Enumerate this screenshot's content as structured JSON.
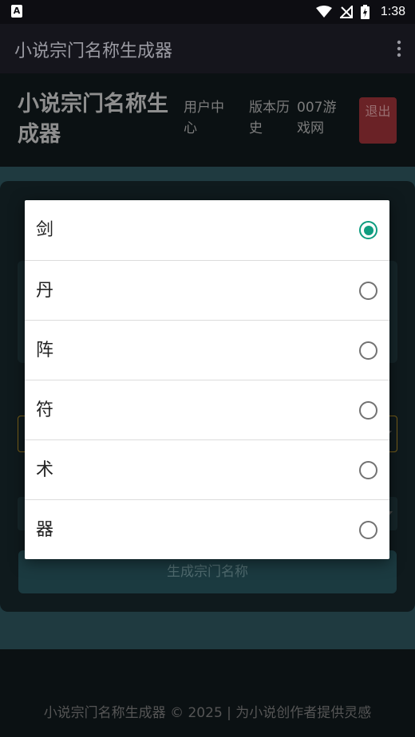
{
  "status_bar": {
    "time": "1:38",
    "app_badge": "A"
  },
  "app_bar": {
    "title": "小说宗门名称生成器"
  },
  "site_header": {
    "title": "小说宗门名称生成器",
    "nav": [
      "用户中心",
      "版本历史",
      "007游戏网"
    ],
    "logout_label": "退出"
  },
  "main": {
    "generate_label": "生成宗门名称"
  },
  "footer": {
    "text": "小说宗门名称生成器 © 2025 | 为小说创作者提供灵感"
  },
  "dialog": {
    "selected_index": 0,
    "options": [
      "剑",
      "丹",
      "阵",
      "符",
      "术",
      "器"
    ]
  },
  "colors": {
    "accent": "#0f9d80",
    "logout": "#6a2226"
  }
}
